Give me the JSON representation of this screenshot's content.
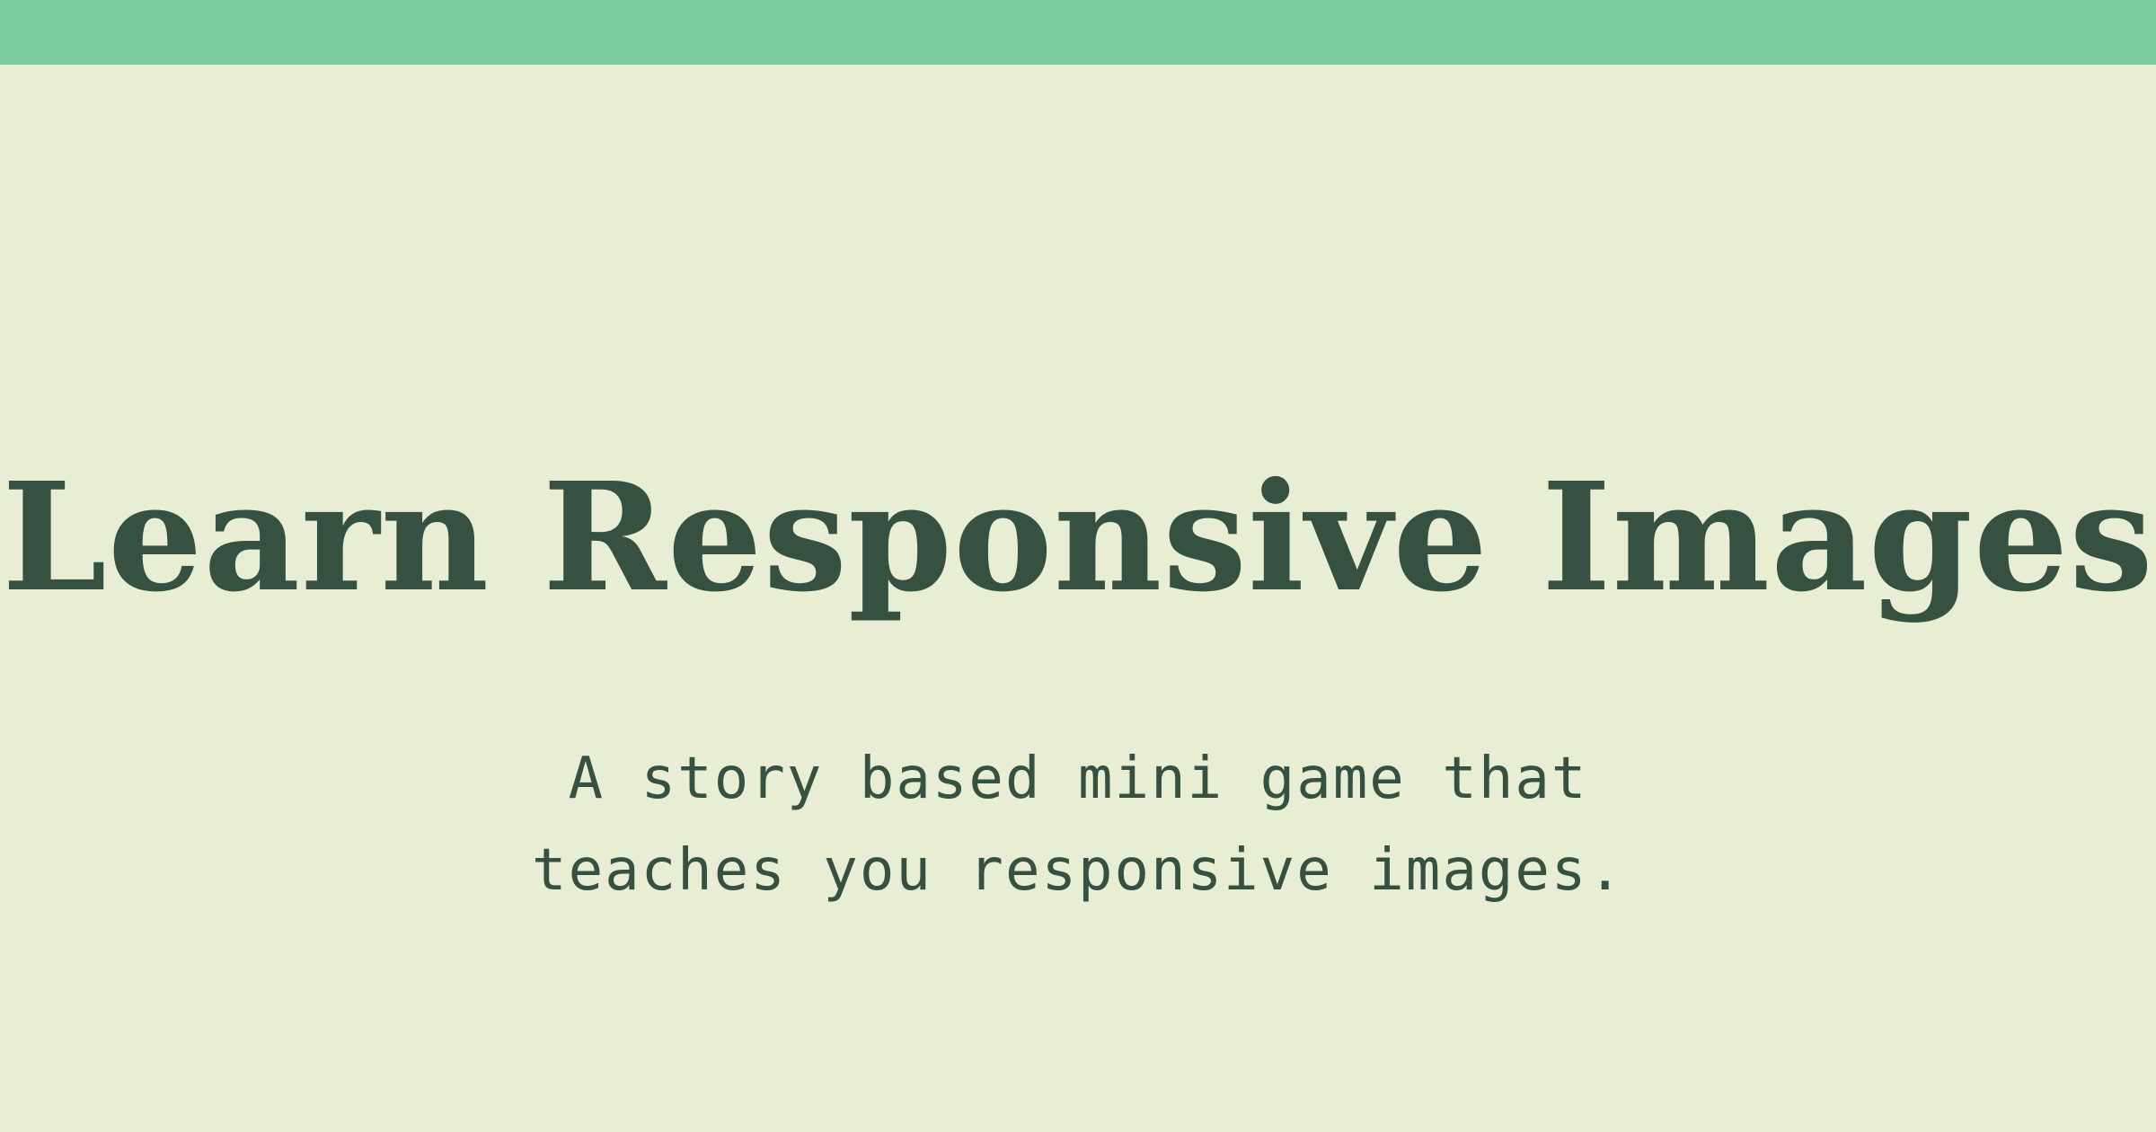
{
  "colors": {
    "background": "#e8eed3",
    "top_bar": "#7ecba0",
    "text": "#365141"
  },
  "hero": {
    "title": "Learn Responsive Images",
    "subtitle_line_1": "A story based mini game that",
    "subtitle_line_2": "teaches you responsive images."
  }
}
